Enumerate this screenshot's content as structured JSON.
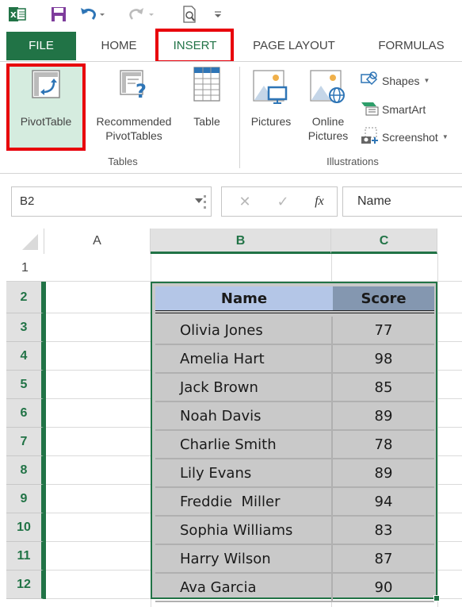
{
  "quick_access": {
    "items": [
      {
        "name": "excel-logo-icon",
        "label": "x"
      },
      {
        "name": "save-icon",
        "label": "save"
      },
      {
        "name": "undo-icon",
        "label": "undo"
      },
      {
        "name": "redo-icon",
        "label": "redo"
      },
      {
        "name": "print-preview-icon",
        "label": "print preview"
      },
      {
        "name": "customize-qat-icon",
        "label": "customize"
      }
    ]
  },
  "tabs": {
    "items": [
      {
        "label": "FILE"
      },
      {
        "label": "HOME"
      },
      {
        "label": "INSERT"
      },
      {
        "label": "PAGE LAYOUT"
      },
      {
        "label": "FORMULAS"
      }
    ],
    "active": "INSERT"
  },
  "ribbon": {
    "groups": {
      "tables": {
        "label": "Tables",
        "buttons": {
          "pivottable": "PivotTable",
          "recommended_line1": "Recommended",
          "recommended_line2": "PivotTables",
          "table": "Table"
        }
      },
      "illustrations": {
        "label": "Illustrations",
        "buttons": {
          "pictures": "Pictures",
          "online_line1": "Online",
          "online_line2": "Pictures",
          "shapes": "Shapes",
          "smartart": "SmartArt",
          "screenshot": "Screenshot"
        }
      }
    }
  },
  "formula_bar": {
    "name_box": "B2",
    "cancel_symbol": "✕",
    "enter_symbol": "✓",
    "fx_label": "fx",
    "formula_value": "Name"
  },
  "grid": {
    "columns": [
      "A",
      "B",
      "C"
    ],
    "selected_columns": [
      "B",
      "C"
    ],
    "rows": [
      "1",
      "2",
      "3",
      "4",
      "5",
      "6",
      "7",
      "8",
      "9",
      "10",
      "11",
      "12"
    ],
    "selected_rows_from": 2,
    "active_cell": "B2"
  },
  "table": {
    "headers": {
      "name": "Name",
      "score": "Score"
    },
    "rows": [
      {
        "name": "Olivia Jones",
        "score": "77"
      },
      {
        "name": "Amelia Hart",
        "score": "98"
      },
      {
        "name": "Jack Brown",
        "score": "85"
      },
      {
        "name": "Noah Davis",
        "score": "89"
      },
      {
        "name": "Charlie Smith",
        "score": "78"
      },
      {
        "name": "Lily Evans",
        "score": "89"
      },
      {
        "name": "Freddie  Miller",
        "score": "94"
      },
      {
        "name": "Sophia Williams",
        "score": "83"
      },
      {
        "name": "Harry Wilson",
        "score": "87"
      },
      {
        "name": "Ava Garcia",
        "score": "90"
      }
    ]
  },
  "colors": {
    "excel_green": "#217346",
    "highlight_red": "#e8000b",
    "header_name_bg": "#b4c6e7",
    "header_score_bg": "#8497b0",
    "table_body_bg": "#c9c9c9",
    "pivot_button_bg": "#d5ecdf"
  }
}
